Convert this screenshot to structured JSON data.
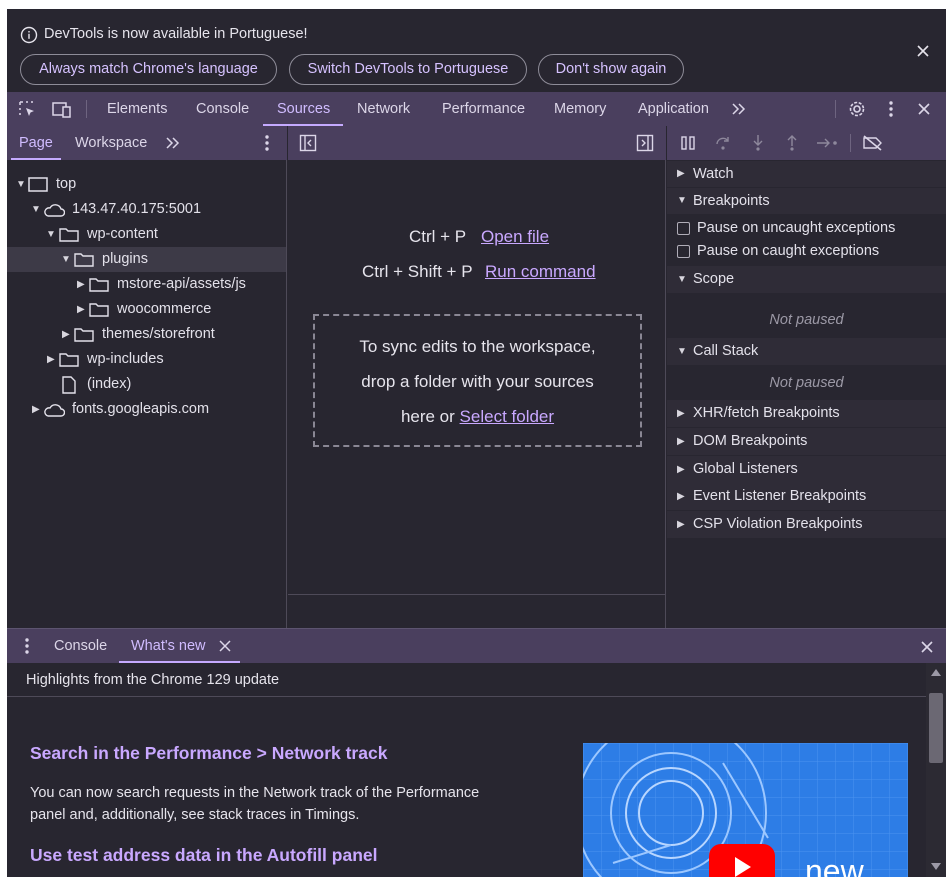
{
  "infobar": {
    "message": "DevTools is now available in Portuguese!",
    "buttons": [
      "Always match Chrome's language",
      "Switch DevTools to Portuguese",
      "Don't show again"
    ]
  },
  "main_tabs": [
    "Elements",
    "Console",
    "Sources",
    "Network",
    "Performance",
    "Memory",
    "Application"
  ],
  "active_main_tab": "Sources",
  "navigator": {
    "tabs": [
      "Page",
      "Workspace"
    ],
    "active_tab": "Page",
    "tree": [
      {
        "label": "top",
        "icon": "frame-icon",
        "expanded": true
      },
      {
        "label": "143.47.40.175:5001",
        "icon": "cloud-icon",
        "expanded": true
      },
      {
        "label": "wp-content",
        "icon": "folder-icon",
        "expanded": true
      },
      {
        "label": "plugins",
        "icon": "folder-icon",
        "expanded": true,
        "selected": true
      },
      {
        "label": "mstore-api/assets/js",
        "icon": "folder-icon",
        "expanded": false
      },
      {
        "label": "woocommerce",
        "icon": "folder-icon",
        "expanded": false
      },
      {
        "label": "themes/storefront",
        "icon": "folder-icon",
        "expanded": false
      },
      {
        "label": "wp-includes",
        "icon": "folder-icon",
        "expanded": false
      },
      {
        "label": "(index)",
        "icon": "file-icon"
      },
      {
        "label": "fonts.googleapis.com",
        "icon": "cloud-icon",
        "expanded": false
      }
    ]
  },
  "editor": {
    "shortcut1_keys": "Ctrl + P",
    "shortcut1_action": "Open file",
    "shortcut2_keys": "Ctrl + Shift + P",
    "shortcut2_action": "Run command",
    "drop_line1": "To sync edits to the workspace,",
    "drop_line2": "drop a folder with your sources",
    "drop_line3_prefix": "here or",
    "drop_link": "Select folder"
  },
  "debugger": {
    "watch": "Watch",
    "breakpoints": "Breakpoints",
    "pause_uncaught": "Pause on uncaught exceptions",
    "pause_caught": "Pause on caught exceptions",
    "scope": "Scope",
    "not_paused": "Not paused",
    "call_stack": "Call Stack",
    "collapsed_sections": [
      "XHR/fetch Breakpoints",
      "DOM Breakpoints",
      "Global Listeners",
      "Event Listener Breakpoints",
      "CSP Violation Breakpoints"
    ]
  },
  "drawer": {
    "tabs": [
      "Console",
      "What's new"
    ],
    "active_tab": "What's new",
    "highlights": "Highlights from the Chrome 129 update",
    "heading1": "Search in the Performance > Network track",
    "para1_line1": "You can now search requests in the Network track of the Performance",
    "para1_line2": "panel and, additionally, see stack traces in Timings.",
    "heading2": "Use test address data in the Autofill panel",
    "video_label": "new"
  },
  "colors": {
    "background": "#282630",
    "toolbar": "#4a3f5e",
    "accent": "#c9a8ff",
    "youtube_red": "#ff0000"
  }
}
